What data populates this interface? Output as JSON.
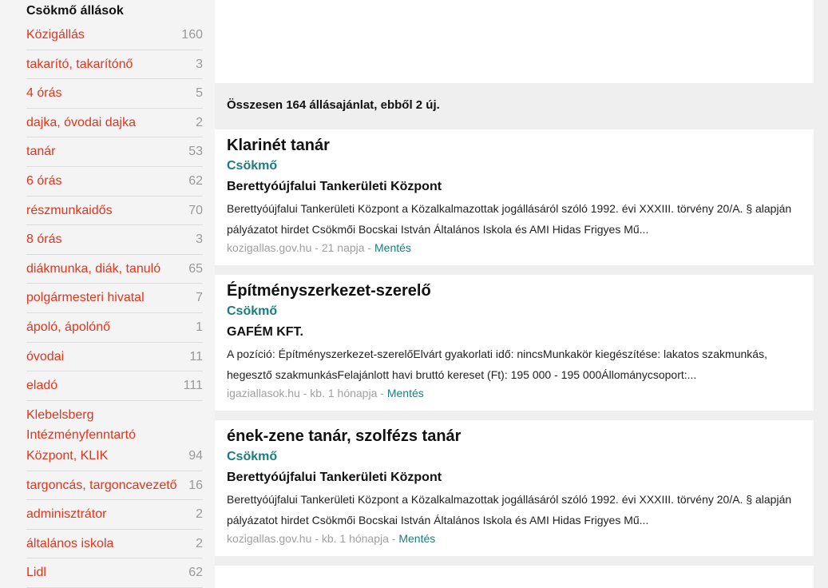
{
  "sidebar": {
    "title": "Csökmő állások",
    "items": [
      {
        "label": "Közigállás",
        "count": "160"
      },
      {
        "label": "takarító, takarítónő",
        "count": "3"
      },
      {
        "label": "4 órás",
        "count": "5"
      },
      {
        "label": "dajka, óvodai dajka",
        "count": "2"
      },
      {
        "label": "tanár",
        "count": "53"
      },
      {
        "label": "6 órás",
        "count": "62"
      },
      {
        "label": "részmunkaidős",
        "count": "70"
      },
      {
        "label": "8 órás",
        "count": "3"
      },
      {
        "label": "diákmunka, diák, tanuló",
        "count": "65"
      },
      {
        "label": "polgármesteri hivatal",
        "count": "7"
      },
      {
        "label": "ápoló, ápolónő",
        "count": "1"
      },
      {
        "label": "óvodai",
        "count": "11"
      },
      {
        "label": "eladó",
        "count": "111"
      },
      {
        "label": "Klebelsberg Intézményfenntartó Központ, KLIK",
        "count": "94"
      },
      {
        "label": "targoncás, targoncavezető",
        "count": "16"
      },
      {
        "label": "adminisztrátor",
        "count": "2"
      },
      {
        "label": "általános iskola",
        "count": "2"
      },
      {
        "label": "Lidl",
        "count": "62"
      }
    ]
  },
  "main": {
    "summary": "Összesen 164 állásajánlat, ebből 2 új.",
    "jobs": [
      {
        "title": "Klarinét tanár",
        "location": "Csökmő",
        "company": "Berettyóújfalui Tankerületi Központ",
        "description": "Berettyóújfalui Tankerületi Központ a Közalkalmazottak jogállásáról szóló 1992. évi XXXIII. törvény 20/A. § alapján pályázatot hirdet Csökmői Bocskai István Általános Iskola és AMI Hidas Frigyes Mű...",
        "source": "kozigallas.gov.hu",
        "age": "21 napja",
        "save": "Mentés"
      },
      {
        "title": "Építményszerkezet-szerelő",
        "location": "Csökmő",
        "company": "GAFÉM KFT.",
        "description": "A pozíció: Építményszerkezet-szerelőElvárt gyakorlati idő: nincsMunkakör kiegészítése: lakatos szakmunkás, hegesztő szakmunkásFelajánlott havi bruttó kereset (Ft): 195 000 - 195 000Állománycsoport:...",
        "source": "igaziallasok.hu",
        "age": "kb. 1 hónapja",
        "save": "Mentés"
      },
      {
        "title": "ének-zene tanár, szolfézs tanár",
        "location": "Csökmő",
        "company": "Berettyóújfalui Tankerületi Központ",
        "description": "Berettyóújfalui Tankerületi Központ a Közalkalmazottak jogállásáról szóló 1992. évi XXXIII. törvény 20/A. § alapján pályázatot hirdet Csökmői Bocskai István Általános Iskola és AMI Hidas Frigyes Mű...",
        "source": "kozigallas.gov.hu",
        "age": "kb. 1 hónapja",
        "save": "Mentés"
      }
    ]
  },
  "colors": {
    "link_red": "#e8321a",
    "teal": "#1a7d7d",
    "count_gray": "#9a9a9a",
    "background": "#efefef"
  }
}
